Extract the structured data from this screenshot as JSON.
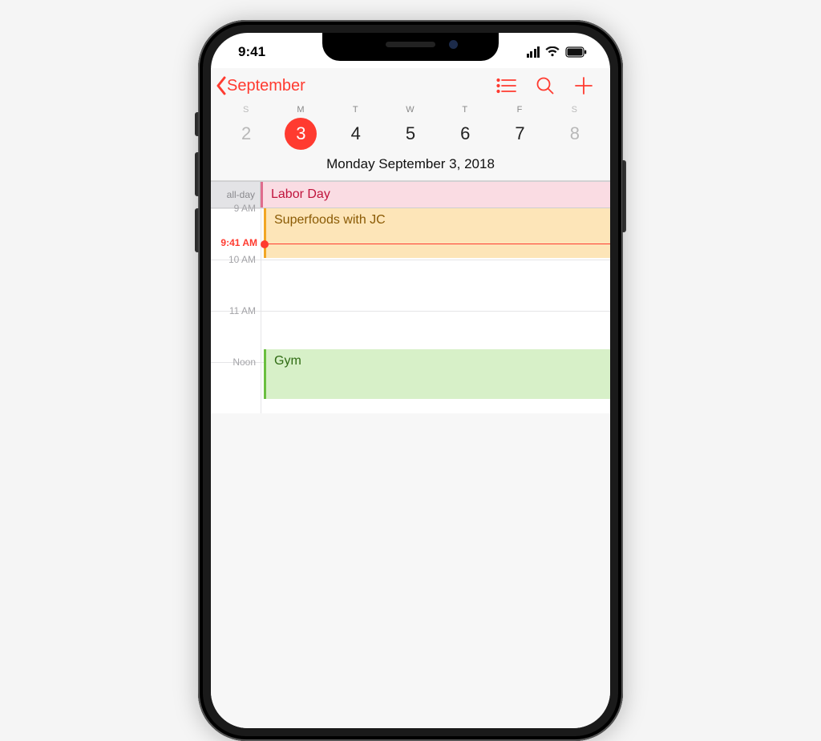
{
  "status": {
    "time": "9:41"
  },
  "nav": {
    "back_label": "September"
  },
  "week": {
    "dow": [
      "S",
      "M",
      "T",
      "W",
      "T",
      "F",
      "S"
    ],
    "days": [
      "2",
      "3",
      "4",
      "5",
      "6",
      "7",
      "8"
    ],
    "selected_index": 1,
    "full_date": "Monday  September 3, 2018"
  },
  "allday": {
    "label": "all-day",
    "event_title": "Labor Day"
  },
  "timeline": {
    "hours": [
      "9 AM",
      "10 AM",
      "11 AM",
      "Noon"
    ],
    "now_label": "9:41 AM",
    "events": [
      {
        "title": "Superfoods with JC",
        "color": "orange",
        "start_row": 0,
        "height_rows": 1
      },
      {
        "title": "Gym",
        "color": "green",
        "start_row": 2.75,
        "height_rows": 1
      }
    ]
  },
  "colors": {
    "accent": "#ff3b30"
  }
}
